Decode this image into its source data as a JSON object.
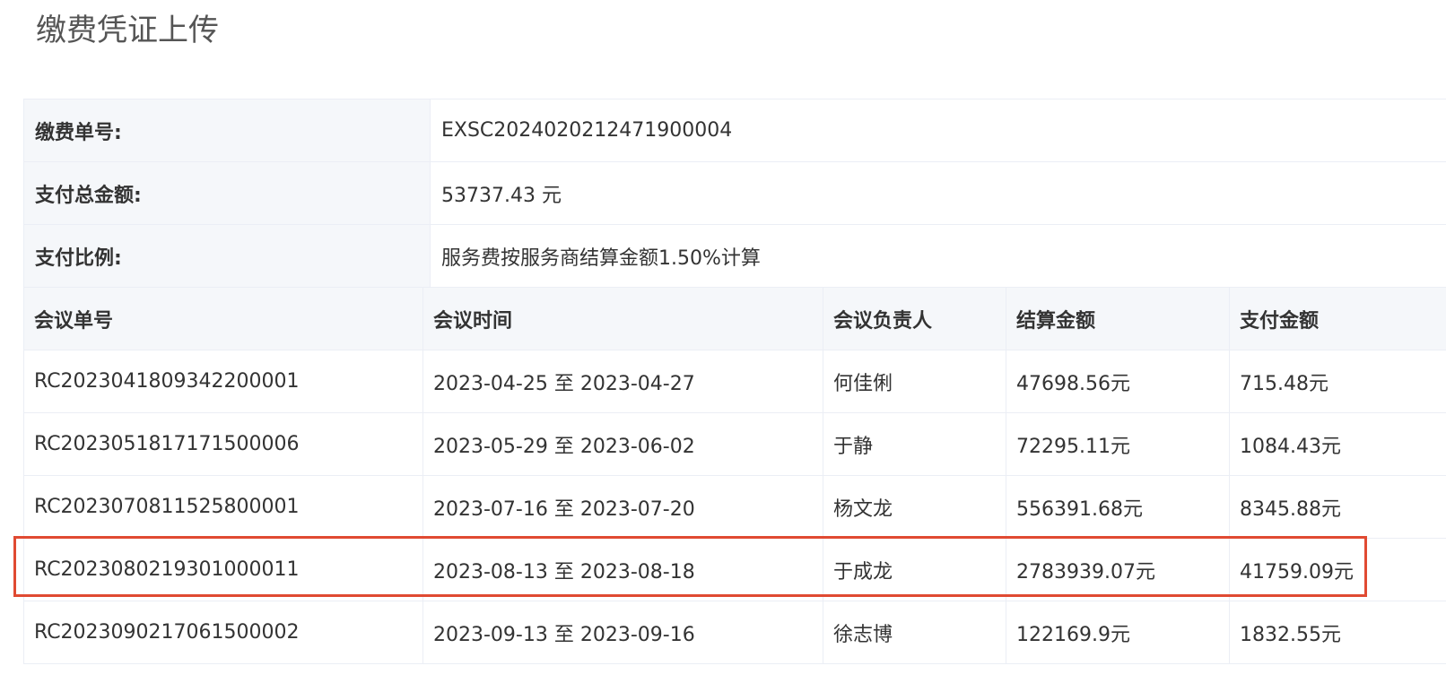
{
  "page": {
    "title": "缴费凭证上传"
  },
  "info": {
    "rows": [
      {
        "label": "缴费单号:",
        "value": "EXSC2024020212471900004"
      },
      {
        "label": "支付总金额:",
        "value": "53737.43 元"
      },
      {
        "label": "支付比例:",
        "value": "服务费按服务商结算金额1.50%计算"
      }
    ]
  },
  "table": {
    "headers": [
      "会议单号",
      "会议时间",
      "会议负责人",
      "结算金额",
      "支付金额"
    ],
    "rows": [
      {
        "id": "RC2023041809342200001",
        "time": "2023-04-25 至 2023-04-27",
        "owner": "何佳俐",
        "settle": "47698.56元",
        "pay": "715.48元"
      },
      {
        "id": "RC2023051817171500006",
        "time": "2023-05-29 至 2023-06-02",
        "owner": "于静",
        "settle": "72295.11元",
        "pay": "1084.43元"
      },
      {
        "id": "RC2023070811525800001",
        "time": "2023-07-16 至 2023-07-20",
        "owner": "杨文龙",
        "settle": "556391.68元",
        "pay": "8345.88元"
      },
      {
        "id": "RC2023080219301000011",
        "time": "2023-08-13 至 2023-08-18",
        "owner": "于成龙",
        "settle": "2783939.07元",
        "pay": "41759.09元"
      },
      {
        "id": "RC2023090217061500002",
        "time": "2023-09-13 至 2023-09-16",
        "owner": "徐志博",
        "settle": "122169.9元",
        "pay": "1832.55元"
      }
    ]
  },
  "highlight": {
    "row_index": 3,
    "color": "#e04a32"
  }
}
